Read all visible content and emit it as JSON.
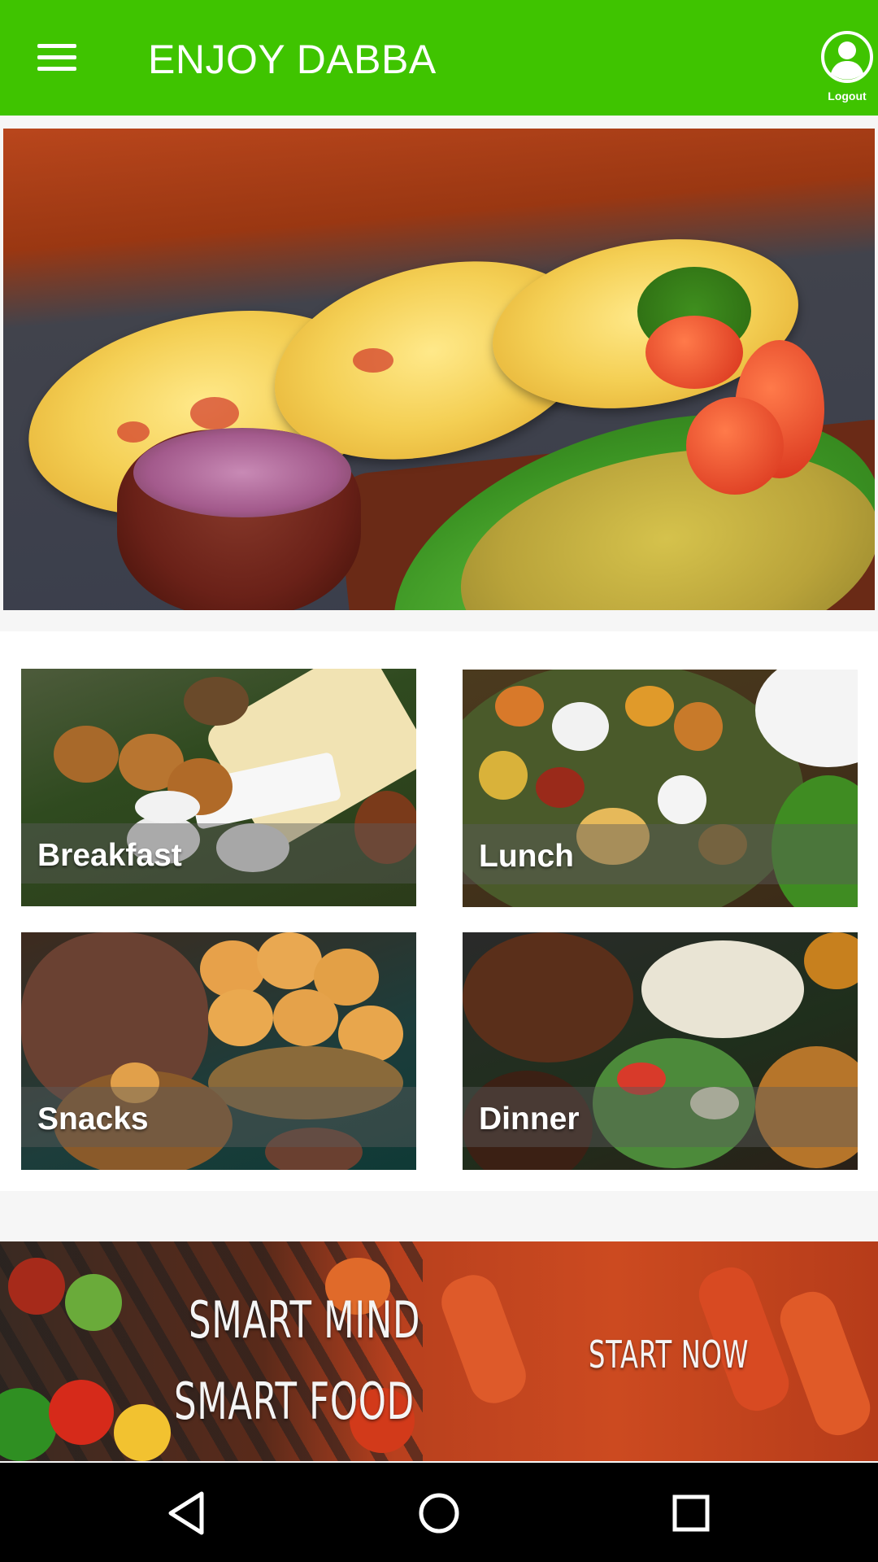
{
  "appbar": {
    "title": "ENJOY DABBA",
    "menu_icon": "hamburger-menu-icon",
    "account_icon": "account-circle-icon",
    "logout_label": "Logout",
    "color": "#3fc400"
  },
  "hero": {
    "image": "uttapam-with-curry-photo"
  },
  "categories": [
    {
      "label": "Breakfast"
    },
    {
      "label": "Lunch"
    },
    {
      "label": "Snacks"
    },
    {
      "label": "Dinner"
    }
  ],
  "promo": {
    "line1": "SMART MIND",
    "line2": "SMART FOOD",
    "cta": "START NOW"
  },
  "navbar": {
    "back_icon": "back-triangle-icon",
    "home_icon": "home-circle-icon",
    "recents_icon": "recents-square-icon"
  }
}
